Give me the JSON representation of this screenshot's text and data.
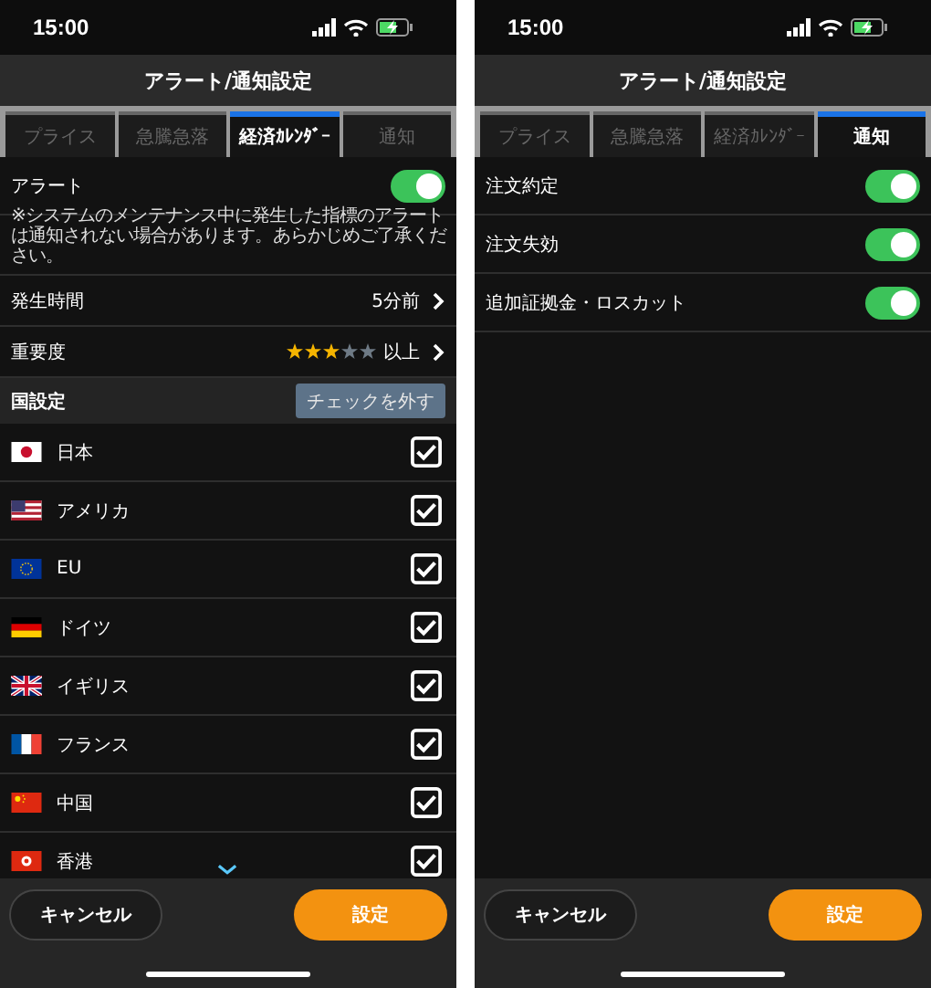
{
  "screens": [
    {
      "status_bar": {
        "time": "15:00"
      },
      "title": "アラート/通知設定",
      "tabs": [
        {
          "label": "プライス",
          "selected": false
        },
        {
          "label": "急騰急落",
          "selected": false
        },
        {
          "label": "経済ｶﾚﾝﾀﾞｰ",
          "selected": true
        },
        {
          "label": "通知",
          "selected": false
        }
      ],
      "rows": [
        {
          "kind": "toggle",
          "label": "アラート",
          "on": true
        },
        {
          "kind": "note",
          "text": "※システムのメンテナンス中に発生した指標のアラートは通知されない場合があります。あらかじめご了承ください。"
        },
        {
          "kind": "link",
          "label": "発生時間",
          "value": "5分前"
        },
        {
          "kind": "stars",
          "label": "重要度",
          "stars": 3,
          "value": "以上"
        },
        {
          "kind": "section",
          "label": "国設定",
          "button": "チェックを外す"
        },
        {
          "kind": "country",
          "label": "日本",
          "checked": true
        },
        {
          "kind": "country",
          "label": "アメリカ",
          "checked": true
        },
        {
          "kind": "country",
          "label": "EU",
          "checked": true
        },
        {
          "kind": "country",
          "label": "ドイツ",
          "checked": true
        },
        {
          "kind": "country",
          "label": "イギリス",
          "checked": true
        },
        {
          "kind": "country",
          "label": "フランス",
          "checked": true
        },
        {
          "kind": "country",
          "label": "中国",
          "checked": true
        },
        {
          "kind": "country",
          "label": "香港",
          "checked": true
        }
      ],
      "more_below": true,
      "buttons": {
        "cancel": "キャンセル",
        "ok": "設定"
      }
    },
    {
      "status_bar": {
        "time": "15:00"
      },
      "title": "アラート/通知設定",
      "tabs": [
        {
          "label": "プライス",
          "selected": false
        },
        {
          "label": "急騰急落",
          "selected": false
        },
        {
          "label": "経済ｶﾚﾝﾀﾞｰ",
          "selected": false
        },
        {
          "label": "通知",
          "selected": true
        }
      ],
      "rows": [
        {
          "kind": "toggle",
          "label": "注文約定",
          "on": true
        },
        {
          "kind": "toggle",
          "label": "注文失効",
          "on": true
        },
        {
          "kind": "toggle",
          "label": "追加証拠金・ロスカット",
          "on": true
        }
      ],
      "buttons": {
        "cancel": "キャンセル",
        "ok": "設定"
      }
    }
  ]
}
